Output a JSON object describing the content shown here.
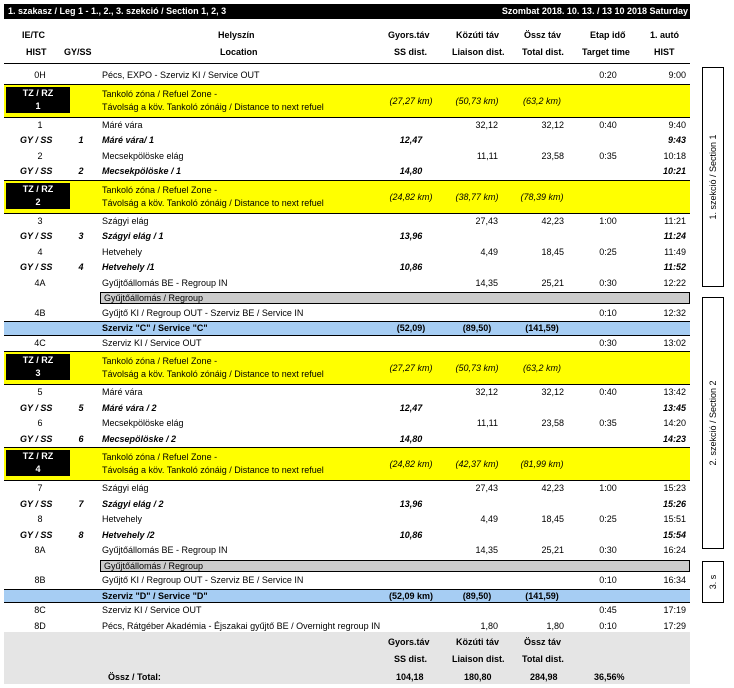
{
  "title": {
    "left": "1. szakasz / Leg 1 - 1., 2., 3. szekció / Section 1, 2, 3",
    "right": "Szombat 2018. 10. 13. / 13 10 2018 Saturday"
  },
  "headers": {
    "ietc": "IE/TC",
    "hist": "HIST",
    "gyss": "GY/SS",
    "helyszin": "Helyszín",
    "location": "Location",
    "gyorstav": "Gyors.táv",
    "ssdist": "SS dist.",
    "kozutitav": "Közúti táv",
    "liaison": "Liaison dist.",
    "ossztav": "Össz táv",
    "total": "Total dist.",
    "etapido": "Etap idő",
    "target": "Target time",
    "auto": "1. autó",
    "hist2": "HIST"
  },
  "rows": [
    {
      "type": "n",
      "hist": "0H",
      "loc": "Pécs, EXPO - Szerviz KI / Service OUT",
      "target": "0:20",
      "time": "9:00"
    },
    {
      "type": "y",
      "tz": [
        "TZ / RZ",
        "1"
      ],
      "l1": "Tankoló zóna / Refuel Zone -",
      "l2": "Távolság a köv. Tankoló zónáig / Distance to next refuel",
      "ss": "(27,27 km)",
      "liaison": "(50,73 km)",
      "total": "(63,2 km)"
    },
    {
      "type": "n",
      "hist": "1",
      "loc": "Máré vára",
      "liaison": "32,12",
      "total": "32,12",
      "target": "0:40",
      "time": "9:40"
    },
    {
      "type": "s",
      "hist": "GY / SS",
      "num": "1",
      "loc": "Máré vára/ 1",
      "ss": "12,47",
      "time": "9:43"
    },
    {
      "type": "n",
      "hist": "2",
      "loc": "Mecsekpölöske elág",
      "liaison": "11,11",
      "total": "23,58",
      "target": "0:35",
      "time": "10:18"
    },
    {
      "type": "s",
      "hist": "GY / SS",
      "num": "2",
      "loc": "Mecsekpölöske / 1",
      "ss": "14,80",
      "time": "10:21"
    },
    {
      "type": "y",
      "tz": [
        "TZ / RZ",
        "2"
      ],
      "l1": "Tankoló zóna / Refuel Zone -",
      "l2": "Távolság a köv. Tankoló zónáig / Distance to next refuel",
      "ss": "(24,82 km)",
      "liaison": "(38,77 km)",
      "total": "(78,39 km)"
    },
    {
      "type": "n",
      "hist": "3",
      "loc": "Szágyi elág",
      "liaison": "27,43",
      "total": "42,23",
      "target": "1:00",
      "time": "11:21"
    },
    {
      "type": "s",
      "hist": "GY / SS",
      "num": "3",
      "loc": "Szágyi elág / 1",
      "ss": "13,96",
      "time": "11:24"
    },
    {
      "type": "n",
      "hist": "4",
      "loc": "Hetvehely",
      "liaison": "4,49",
      "total": "18,45",
      "target": "0:25",
      "time": "11:49"
    },
    {
      "type": "s",
      "hist": "GY / SS",
      "num": "4",
      "loc": "Hetvehely /1",
      "ss": "10,86",
      "time": "11:52"
    },
    {
      "type": "n",
      "hist": "4A",
      "loc": "Gyűjtőállomás BE - Regroup IN",
      "liaison": "14,35",
      "total": "25,21",
      "target": "0:30",
      "time": "12:22"
    },
    {
      "type": "g",
      "loc": "Gyűjtőállomás / Regroup"
    },
    {
      "type": "n",
      "hist": "4B",
      "loc": "Gyűjtő KI / Regroup OUT - Szerviz BE / Service IN",
      "target": "0:10",
      "time": "12:32"
    },
    {
      "type": "b",
      "loc": "Szerviz \"C\" / Service \"C\"",
      "ss": "(52,09)",
      "liaison": "(89,50)",
      "total": "(141,59)"
    },
    {
      "type": "n",
      "hist": "4C",
      "loc": "Szerviz KI / Service OUT",
      "target": "0:30",
      "time": "13:02"
    },
    {
      "type": "y",
      "tz": [
        "TZ / RZ",
        "3"
      ],
      "l1": "Tankoló zóna / Refuel Zone -",
      "l2": "Távolság a köv. Tankoló zónáig / Distance to next refuel",
      "ss": "(27,27 km)",
      "liaison": "(50,73 km)",
      "total": "(63,2 km)"
    },
    {
      "type": "n",
      "hist": "5",
      "loc": "Máré vára",
      "liaison": "32,12",
      "total": "32,12",
      "target": "0:40",
      "time": "13:42"
    },
    {
      "type": "s",
      "hist": "GY / SS",
      "num": "5",
      "loc": "Máré vára / 2",
      "ss": "12,47",
      "time": "13:45"
    },
    {
      "type": "n",
      "hist": "6",
      "loc": "Mecsekpölöske elág",
      "liaison": "11,11",
      "total": "23,58",
      "target": "0:35",
      "time": "14:20"
    },
    {
      "type": "s",
      "hist": "GY / SS",
      "num": "6",
      "loc": "Mecsepölöske / 2",
      "ss": "14,80",
      "time": "14:23"
    },
    {
      "type": "y",
      "tz": [
        "TZ / RZ",
        "4"
      ],
      "l1": "Tankoló zóna / Refuel Zone -",
      "l2": "Távolság a köv. Tankoló zónáig / Distance to next refuel",
      "ss": "(24,82 km)",
      "liaison": "(42,37 km)",
      "total": "(81,99 km)"
    },
    {
      "type": "n",
      "hist": "7",
      "loc": "Szágyi elág",
      "liaison": "27,43",
      "total": "42,23",
      "target": "1:00",
      "time": "15:23"
    },
    {
      "type": "s",
      "hist": "GY / SS",
      "num": "7",
      "loc": "Szágyi elág / 2",
      "ss": "13,96",
      "time": "15:26"
    },
    {
      "type": "n",
      "hist": "8",
      "loc": "Hetvehely",
      "liaison": "4,49",
      "total": "18,45",
      "target": "0:25",
      "time": "15:51"
    },
    {
      "type": "s",
      "hist": "GY / SS",
      "num": "8",
      "loc": "Hetvehely /2",
      "ss": "10,86",
      "time": "15:54"
    },
    {
      "type": "n",
      "hist": "8A",
      "loc": "Gyűjtőállomás BE - Regroup IN",
      "liaison": "14,35",
      "total": "25,21",
      "target": "0:30",
      "time": "16:24"
    },
    {
      "type": "g",
      "loc": "Gyűjtőállomás / Regroup"
    },
    {
      "type": "n",
      "hist": "8B",
      "loc": "Gyűjtő KI / Regroup OUT - Szerviz BE / Service IN",
      "target": "0:10",
      "time": "16:34"
    },
    {
      "type": "b",
      "loc": "Szerviz \"D\" / Service \"D\"",
      "ss": "(52,09 km)",
      "liaison": "(89,50)",
      "total": "(141,59)"
    },
    {
      "type": "n",
      "hist": "8C",
      "loc": "Szerviz KI / Service OUT",
      "target": "0:45",
      "time": "17:19"
    },
    {
      "type": "n",
      "hist": "8D",
      "loc": "Pécs, Rátgéber Akadémia - Éjszakai gyűjtő BE / Overnight regroup IN",
      "liaison": "1,80",
      "total": "1,80",
      "target": "0:10",
      "time": "17:29"
    }
  ],
  "footer": {
    "gyorstav": "Gyors.táv",
    "ssdist": "SS dist.",
    "kozutitav": "Közúti táv",
    "liaison": "Liaison dist.",
    "ossztav": "Össz táv",
    "total": "Total dist.",
    "label": "Össz / Total:",
    "sum_ss": "104,18",
    "sum_liaison": "180,80",
    "sum_total": "284,98",
    "percent": "36,56%"
  },
  "side_labels": {
    "s1": "1. szekció / Section 1",
    "s2": "2. szekció / Section 2",
    "s3": "3. s"
  }
}
